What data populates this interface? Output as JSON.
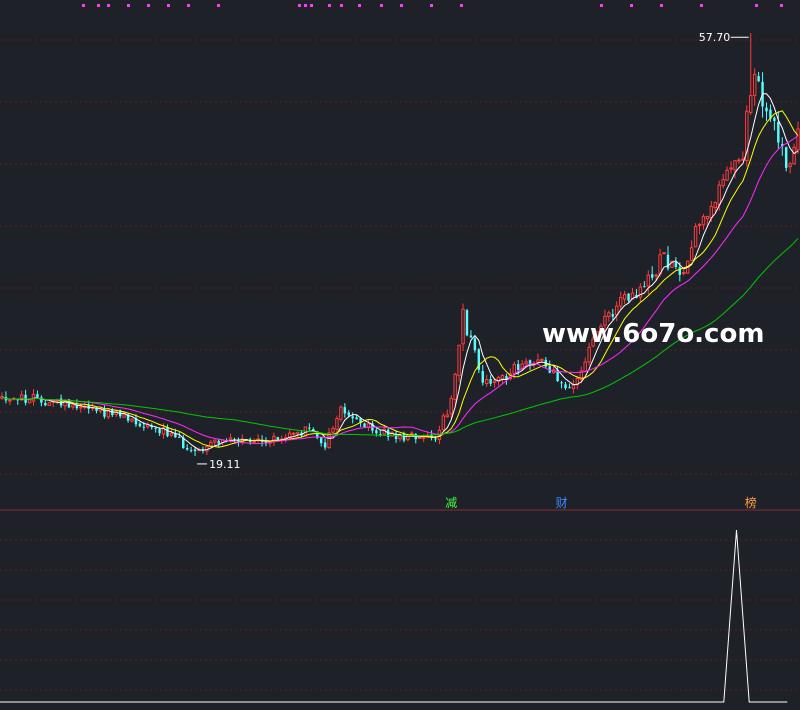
{
  "colors": {
    "background": "#1f2129",
    "grid": "#5a1e26",
    "up": "#ff3b3b",
    "down": "#54ffff",
    "ma5": "#ffffff",
    "ma10": "#ffff00",
    "ma20": "#ff2bff",
    "ma60": "#00c800",
    "indicator": "#ffffff",
    "watermark": "#ffffff",
    "tag_red": "#ff2020",
    "tag_green": "#40ff40",
    "tag_blue": "#3c8cff",
    "tag_orange": "#ffa040",
    "marker_dots": "#ff3bff"
  },
  "watermark": "www.6o7o.com",
  "high_label": "57.70",
  "low_label": "19.11",
  "event_tags": [
    {
      "text": "减",
      "index": 114,
      "color_key": "tag_green"
    },
    {
      "text": "财",
      "index": 142,
      "color_key": "tag_blue"
    },
    {
      "text": "榜",
      "index": 190,
      "color_key": "tag_orange"
    }
  ],
  "chart_data": [
    {
      "type": "candlestick",
      "title": "",
      "ylim": [
        16,
        60
      ],
      "moving_averages": [
        "MA5",
        "MA10",
        "MA20",
        "MA60"
      ],
      "high": {
        "value": 57.7,
        "index": 190
      },
      "low": {
        "value": 19.11,
        "index": 49
      },
      "grid": true,
      "x_count": 203,
      "y_min": 16,
      "y_max": 60
    },
    {
      "type": "line",
      "title": "",
      "series": [
        {
          "values": [
            0,
            0,
            0,
            0,
            0,
            0,
            0,
            0,
            0,
            0,
            0,
            0,
            0,
            0,
            0,
            0,
            0,
            0,
            0,
            0,
            0,
            0,
            0,
            0,
            0,
            0,
            0,
            0,
            0,
            0,
            0,
            0,
            0,
            0,
            0,
            0,
            0,
            0,
            0,
            0,
            0,
            0,
            0,
            0,
            0,
            0,
            0,
            0,
            0,
            0,
            0,
            0,
            0,
            0,
            0,
            0,
            0,
            0,
            100,
            0,
            0,
            0,
            0
          ]
        }
      ],
      "ylim": [
        0,
        100
      ],
      "grid": true
    }
  ]
}
